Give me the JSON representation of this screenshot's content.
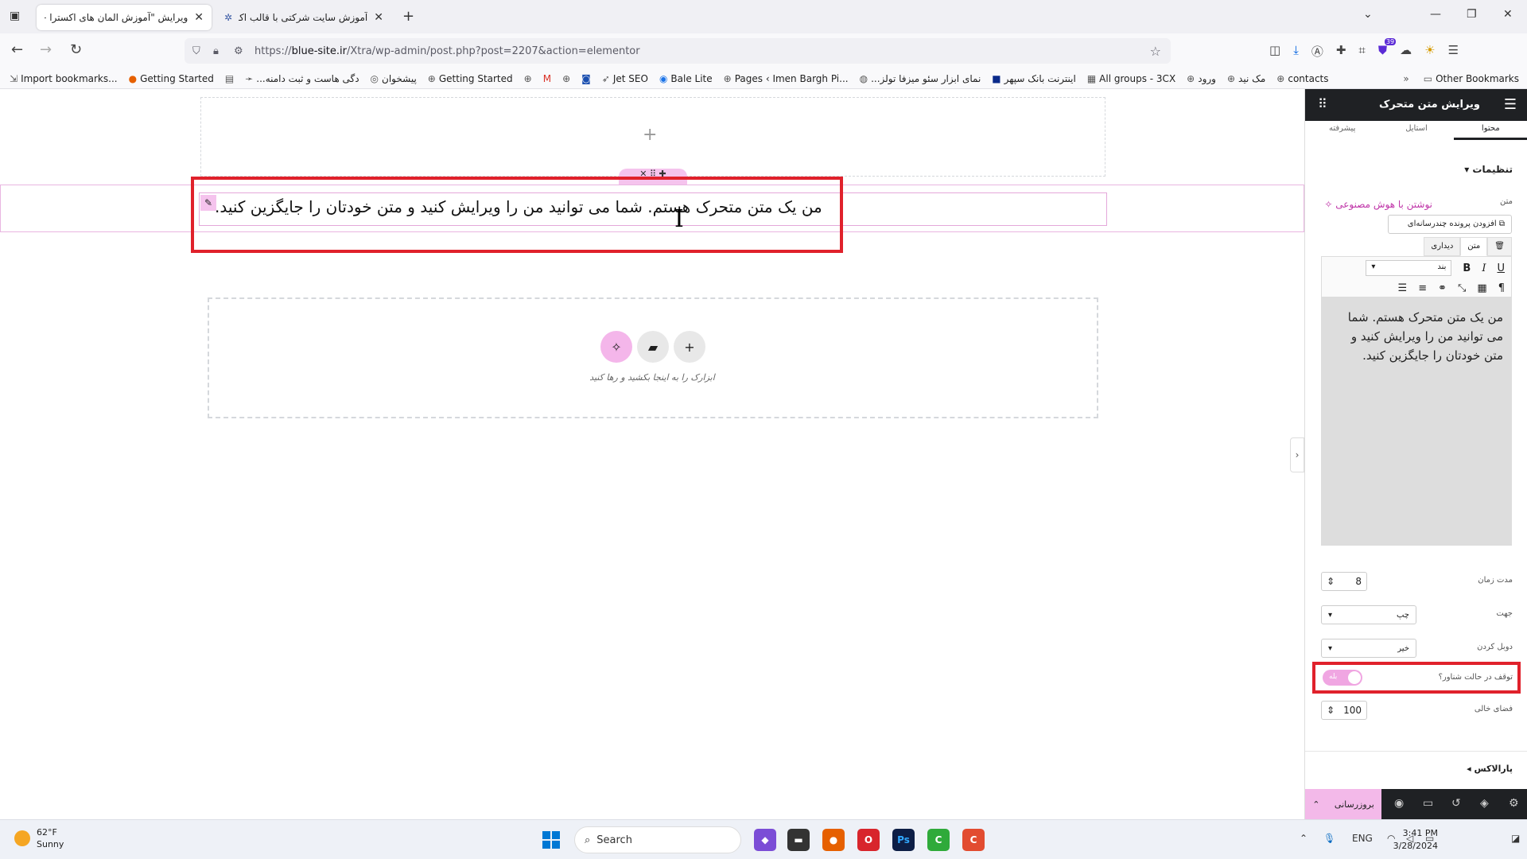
{
  "browser": {
    "tabs": [
      {
        "title": "ویرایش \"آموزش المان های اکسترا – ما"
      },
      {
        "title": "آموزش سایت شرکتی با قالب اکس"
      }
    ],
    "url_prefix": "https://",
    "url_domain": "blue-site.ir",
    "url_path": "/Xtra/wp-admin/post.php?post=2207&action=elementor",
    "bookmarks": [
      "Import bookmarks...",
      "Getting Started",
      "...دگی هاست و ثبت دامنه",
      "پیشخوان",
      "Getting Started",
      "Jet SEO",
      "Bale Lite",
      "Pages ‹ Imen Bargh Pi...",
      "...نمای ابزار سئو میزفا تولز",
      "اینترنت بانک سپهر",
      "All groups - 3CX",
      "ورود",
      "مک نید",
      "contacts"
    ],
    "other_bookmarks": "Other Bookmarks",
    "extension_badge": "39"
  },
  "canvas": {
    "marquee_text": "من یک متن متحرک هستم. شما می توانید من را ویرایش کنید و متن خودتان را جایگزین کنید.",
    "drop_hint": "ابزارک را به اینجا بکشید و رها کنید"
  },
  "panel": {
    "title": "ویرایش متن متحرک",
    "tabs": [
      "پیشرفته",
      "استایل",
      "محتوا"
    ],
    "section_settings": "تنظیمات",
    "label_text": "متن",
    "ai_button": "نوشتن با هوش مصنوعی",
    "add_media": "افزودن پرونده چندرسانه‌ای",
    "editor_tab_visual": "دیداری",
    "editor_tab_text": "متن",
    "format_select": "بند",
    "editor_content": "من یک متن متحرک هستم. شما می توانید من را ویرایش کنید و متن خودتان را جایگزین کنید.",
    "duration_label": "مدت زمان",
    "duration_value": "8",
    "direction_label": "جهت",
    "direction_value": "چپ",
    "loop_label": "دوبل کردن",
    "loop_value": "خیر",
    "pause_label": "توقف در حالت شناور؟",
    "pause_value": "بله",
    "gap_label": "فضای خالی",
    "gap_value": "100",
    "parallax_section": "پارالاکس",
    "publish_label": "بروزرسانی"
  },
  "taskbar": {
    "temperature": "62°F",
    "weather": "Sunny",
    "search_placeholder": "Search",
    "lang": "ENG",
    "time": "3:41 PM",
    "date": "3/28/2024"
  },
  "colors": {
    "highlight_red": "#e0212b",
    "elementor_pink": "#f3b9e9",
    "panel_dark": "#1f2124"
  }
}
